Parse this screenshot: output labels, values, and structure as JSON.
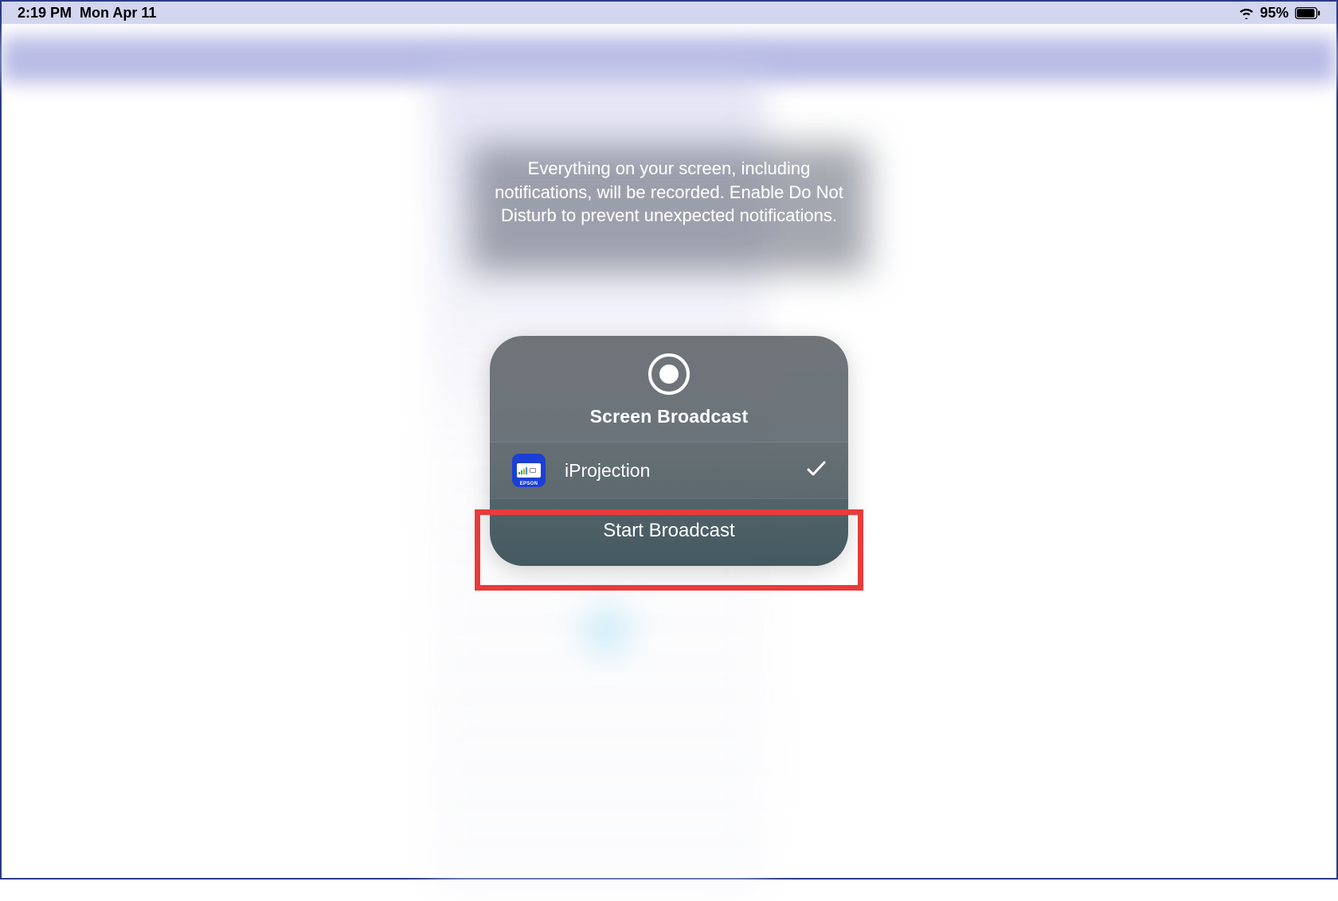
{
  "status_bar": {
    "time": "2:19 PM",
    "date": "Mon Apr 11",
    "battery_pct": "95%"
  },
  "info_message": "Everything on your screen, including notifications, will be recorded. Enable Do Not Disturb to prevent unexpected notifications.",
  "popup": {
    "title": "Screen Broadcast",
    "app": {
      "name": "iProjection",
      "icon_label": "EPSON"
    },
    "action_label": "Start Broadcast"
  }
}
